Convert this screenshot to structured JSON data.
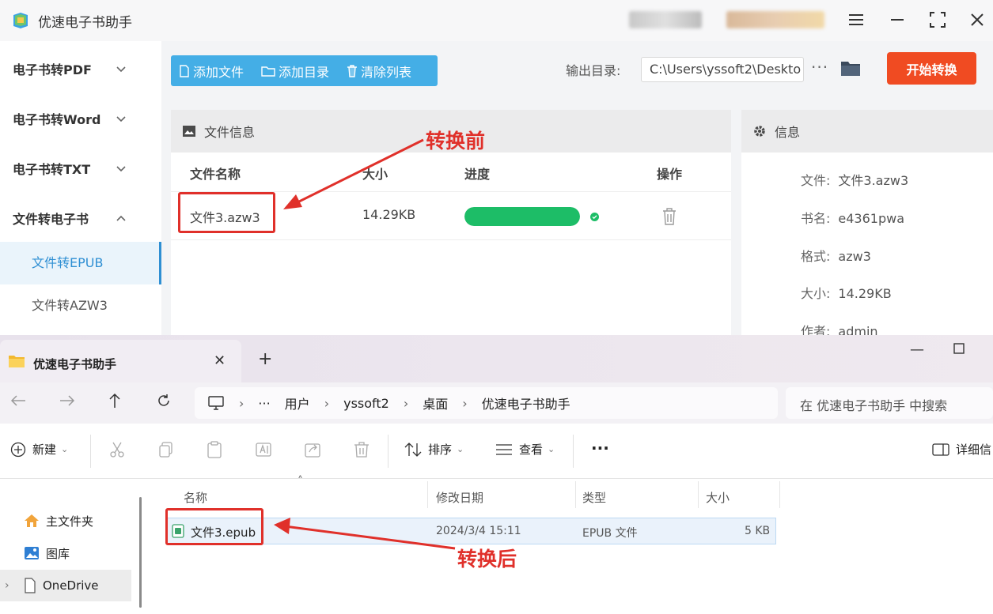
{
  "app": {
    "title": "优速电子书助手",
    "sidebar": {
      "groups": [
        {
          "label": "电子书转PDF",
          "expanded": false
        },
        {
          "label": "电子书转Word",
          "expanded": false
        },
        {
          "label": "电子书转TXT",
          "expanded": false
        },
        {
          "label": "文件转电子书",
          "expanded": true
        }
      ],
      "subitems": [
        {
          "label": "文件转EPUB",
          "active": true
        },
        {
          "label": "文件转AZW3",
          "active": false
        }
      ]
    },
    "toolbar": {
      "add_file": "添加文件",
      "add_dir": "添加目录",
      "clear_list": "清除列表"
    },
    "output": {
      "label": "输出目录:",
      "path": "C:\\Users\\yssoft2\\Deskto",
      "more": "···"
    },
    "start_button": "开始转换",
    "file_panel": {
      "title": "文件信息",
      "columns": [
        "文件名称",
        "大小",
        "进度",
        "操作"
      ],
      "rows": [
        {
          "name": "文件3.azw3",
          "size": "14.29KB",
          "progress": 1.0
        }
      ]
    },
    "info_panel": {
      "title": "信息",
      "fields": [
        {
          "key": "文件:",
          "value": "文件3.azw3"
        },
        {
          "key": "书名:",
          "value": "e4361pwa"
        },
        {
          "key": "格式:",
          "value": "azw3"
        },
        {
          "key": "大小:",
          "value": "14.29KB"
        },
        {
          "key": "作者:",
          "value": "admin"
        }
      ]
    }
  },
  "explorer": {
    "tab_title": "优速电子书助手",
    "breadcrumb": [
      "用户",
      "yssoft2",
      "桌面",
      "优速电子书助手"
    ],
    "breadcrumb_more": "···",
    "search_placeholder": "在 优速电子书助手 中搜索",
    "commands": {
      "new": "新建",
      "sort": "排序",
      "view": "查看",
      "more": "···",
      "details": "详细信"
    },
    "tree": [
      "主文件夹",
      "图库",
      "OneDrive"
    ],
    "columns": [
      "名称",
      "修改日期",
      "类型",
      "大小"
    ],
    "files": [
      {
        "name": "文件3.epub",
        "modified": "2024/3/4 15:11",
        "type": "EPUB 文件",
        "size": "5 KB"
      }
    ]
  },
  "annotations": {
    "before": "转换前",
    "after": "转换后"
  },
  "colors": {
    "accent_blue": "#44aee6",
    "start_red": "#f04b22",
    "progress_green": "#1dbd67",
    "annotation_red": "#e0302a"
  }
}
